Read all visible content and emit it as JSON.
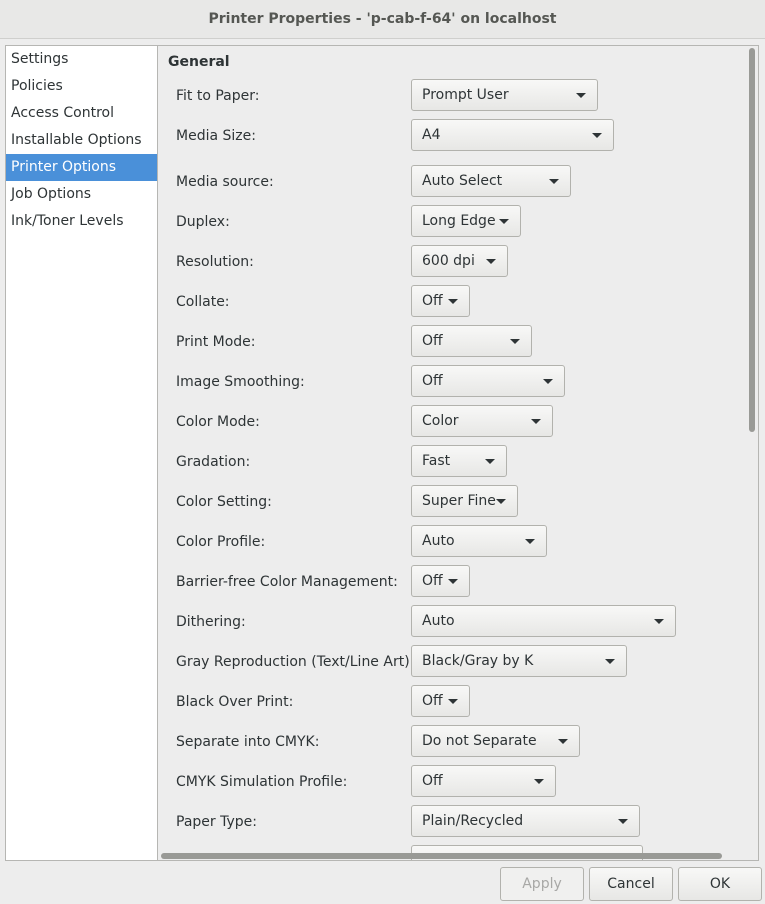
{
  "window": {
    "title": "Printer Properties - 'p-cab-f-64' on localhost"
  },
  "sidebar": {
    "items": [
      {
        "label": "Settings",
        "selected": false
      },
      {
        "label": "Policies",
        "selected": false
      },
      {
        "label": "Access Control",
        "selected": false
      },
      {
        "label": "Installable Options",
        "selected": false
      },
      {
        "label": "Printer Options",
        "selected": true
      },
      {
        "label": "Job Options",
        "selected": false
      },
      {
        "label": "Ink/Toner Levels",
        "selected": false
      }
    ]
  },
  "main": {
    "section_title": "General",
    "options": [
      {
        "label": "Fit to Paper:",
        "value": "Prompt User"
      },
      {
        "label": "Media Size:",
        "value": "A4"
      },
      {
        "label": "Media source:",
        "value": "Auto Select"
      },
      {
        "label": "Duplex:",
        "value": "Long Edge"
      },
      {
        "label": "Resolution:",
        "value": "600 dpi"
      },
      {
        "label": "Collate:",
        "value": "Off"
      },
      {
        "label": "Print Mode:",
        "value": "Off"
      },
      {
        "label": "Image Smoothing:",
        "value": "Off"
      },
      {
        "label": "Color Mode:",
        "value": "Color"
      },
      {
        "label": "Gradation:",
        "value": "Fast"
      },
      {
        "label": "Color Setting:",
        "value": "Super Fine"
      },
      {
        "label": "Color Profile:",
        "value": "Auto"
      },
      {
        "label": "Barrier-free Color Management:",
        "value": "Off"
      },
      {
        "label": "Dithering:",
        "value": "Auto"
      },
      {
        "label": "Gray Reproduction (Text/Line Art):",
        "value": "Black/Gray by K"
      },
      {
        "label": "Black Over Print:",
        "value": "Off"
      },
      {
        "label": "Separate into CMYK:",
        "value": "Do not Separate"
      },
      {
        "label": "CMYK Simulation Profile:",
        "value": "Off"
      },
      {
        "label": "Paper Type:",
        "value": "Plain/Recycled"
      }
    ]
  },
  "buttons": {
    "apply": "Apply",
    "cancel": "Cancel",
    "ok": "OK"
  },
  "colors": {
    "selection": "#4a90d9",
    "window_bg": "#ededed"
  }
}
